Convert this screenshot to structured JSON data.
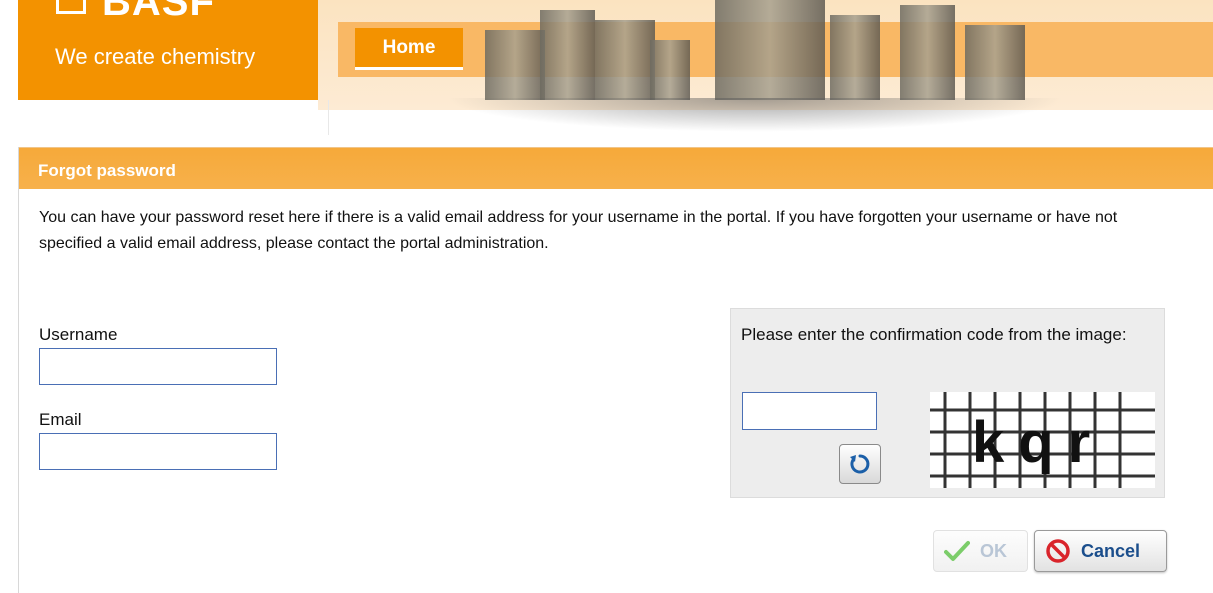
{
  "header": {
    "logo_word": "BASF",
    "tagline": "We create chemistry",
    "nav": {
      "home_label": "Home"
    }
  },
  "panel": {
    "title": "Forgot password",
    "intro": "You can have your password reset here if there is a valid email address for your username in the portal. If you have forgotten your username or have not specified a valid email address, please contact the portal administration.",
    "username_label": "Username",
    "username_value": "",
    "email_label": "Email",
    "email_value": "",
    "captcha": {
      "prompt": "Please enter the confirmation code from the image:",
      "value": "",
      "refresh_icon": "refresh-icon",
      "image_text": "kqr"
    },
    "buttons": {
      "ok_label": "OK",
      "ok_icon": "checkmark-icon",
      "cancel_label": "Cancel",
      "cancel_icon": "cancel-icon"
    }
  },
  "colors": {
    "brand_orange": "#f39200",
    "title_bar": "#f6a93a",
    "input_border": "#4a6fb5",
    "ok_check": "#7ccd6a",
    "cancel_red": "#d9242b",
    "cancel_text": "#1b4e8c"
  }
}
